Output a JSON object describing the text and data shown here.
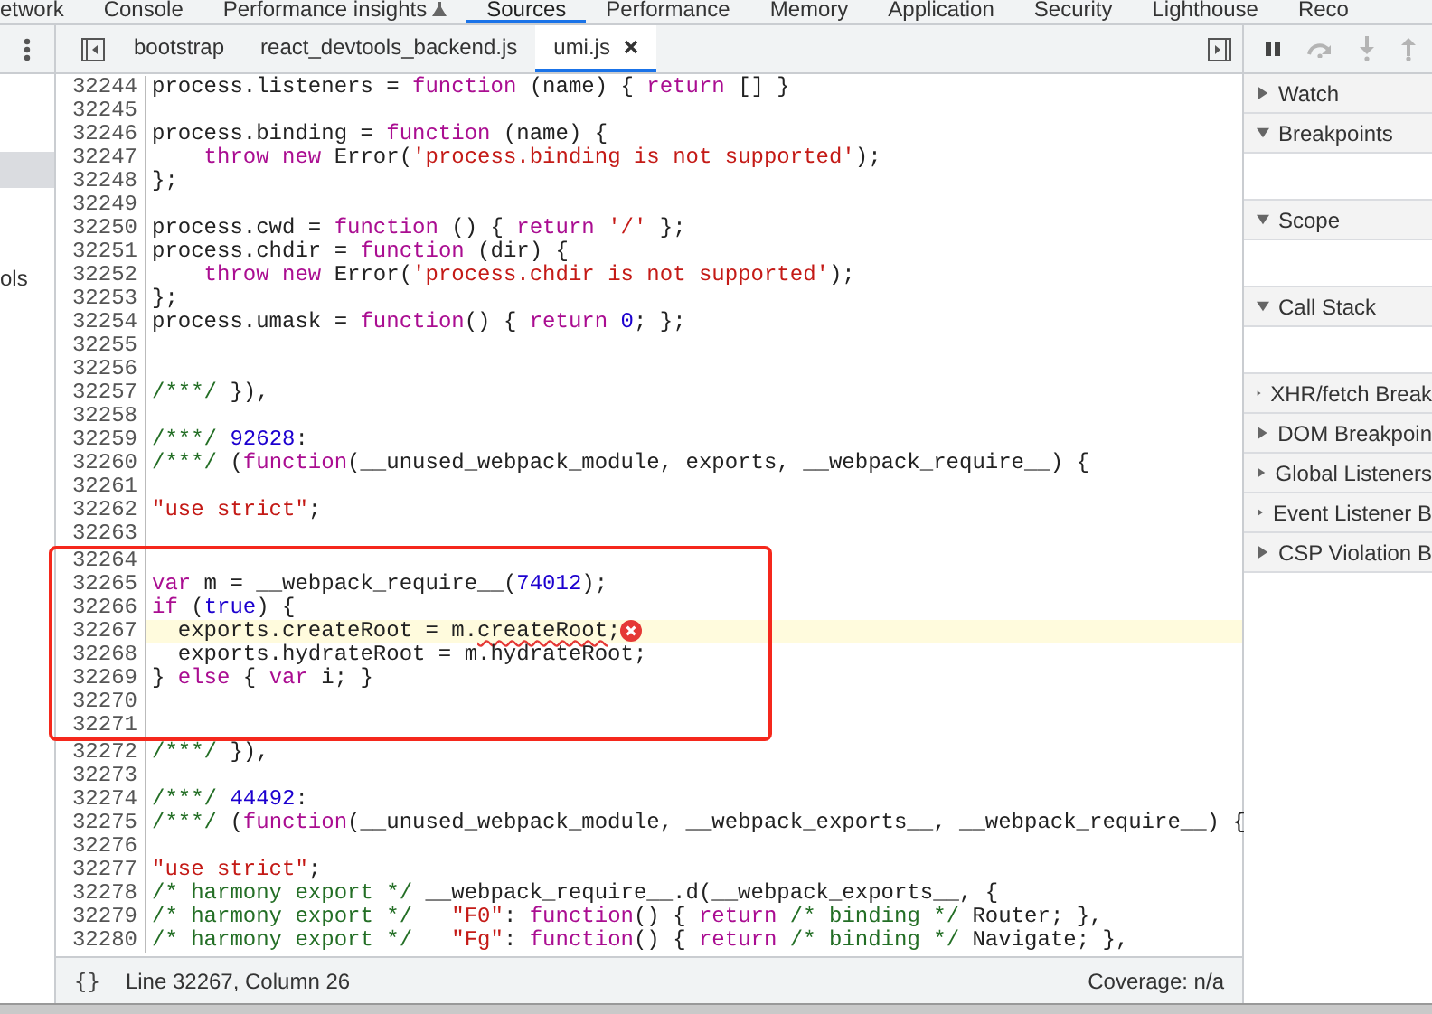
{
  "top_tabs": [
    {
      "label": "etwork",
      "selected": false,
      "has_icon": false
    },
    {
      "label": "Console",
      "selected": false,
      "has_icon": false
    },
    {
      "label": "Performance insights",
      "selected": false,
      "has_icon": true
    },
    {
      "label": "Sources",
      "selected": true,
      "has_icon": false
    },
    {
      "label": "Performance",
      "selected": false,
      "has_icon": false
    },
    {
      "label": "Memory",
      "selected": false,
      "has_icon": false
    },
    {
      "label": "Application",
      "selected": false,
      "has_icon": false
    },
    {
      "label": "Security",
      "selected": false,
      "has_icon": false
    },
    {
      "label": "Lighthouse",
      "selected": false,
      "has_icon": false
    },
    {
      "label": "Reco",
      "selected": false,
      "has_icon": false
    }
  ],
  "sidebar": {
    "items": [
      {
        "selected": true
      },
      {
        "label": "ols",
        "selected": false
      }
    ]
  },
  "editor_tabs": [
    {
      "label": "bootstrap",
      "selected": false
    },
    {
      "label": "react_devtools_backend.js",
      "selected": false
    },
    {
      "label": "umi.js",
      "selected": true
    }
  ],
  "code_blocks": [
    {
      "boxed": false,
      "lines": [
        {
          "number": "32244",
          "highlighted": false,
          "tokens": [
            {
              "kind": "plain",
              "text": "process.listeners ="
            },
            {
              "kind": "keyword",
              "text": " function"
            },
            {
              "kind": "plain",
              "text": " (name) {"
            },
            {
              "kind": "keyword",
              "text": " return"
            },
            {
              "kind": "plain",
              "text": " [] }"
            }
          ]
        },
        {
          "number": "32245",
          "highlighted": false
        },
        {
          "number": "32246",
          "highlighted": false,
          "tokens": [
            {
              "kind": "plain",
              "text": "process.binding ="
            },
            {
              "kind": "keyword",
              "text": " function"
            },
            {
              "kind": "plain",
              "text": " (name) {"
            }
          ]
        },
        {
          "number": "32247",
          "highlighted": false,
          "tokens": [
            {
              "kind": "keyword",
              "text": "    throw new"
            },
            {
              "kind": "plain",
              "text": " Error("
            },
            {
              "kind": "string",
              "text": "'process.binding is not supported'"
            },
            {
              "kind": "plain",
              "text": ");"
            }
          ]
        },
        {
          "number": "32248",
          "highlighted": false,
          "tokens": [
            {
              "kind": "plain",
              "text": "};"
            }
          ]
        },
        {
          "number": "32249",
          "highlighted": false
        },
        {
          "number": "32250",
          "highlighted": false,
          "tokens": [
            {
              "kind": "plain",
              "text": "process.cwd ="
            },
            {
              "kind": "keyword",
              "text": " function"
            },
            {
              "kind": "plain",
              "text": " () {"
            },
            {
              "kind": "keyword",
              "text": " return"
            },
            {
              "kind": "string",
              "text": " '/'"
            },
            {
              "kind": "plain",
              "text": " };"
            }
          ]
        },
        {
          "number": "32251",
          "highlighted": false,
          "tokens": [
            {
              "kind": "plain",
              "text": "process.chdir ="
            },
            {
              "kind": "keyword",
              "text": " function"
            },
            {
              "kind": "plain",
              "text": " (dir) {"
            }
          ]
        },
        {
          "number": "32252",
          "highlighted": false,
          "tokens": [
            {
              "kind": "keyword",
              "text": "    throw new"
            },
            {
              "kind": "plain",
              "text": " Error("
            },
            {
              "kind": "string",
              "text": "'process.chdir is not supported'"
            },
            {
              "kind": "plain",
              "text": ");"
            }
          ]
        },
        {
          "number": "32253",
          "highlighted": false,
          "tokens": [
            {
              "kind": "plain",
              "text": "};"
            }
          ]
        },
        {
          "number": "32254",
          "highlighted": false,
          "tokens": [
            {
              "kind": "plain",
              "text": "process.umask ="
            },
            {
              "kind": "keyword",
              "text": " function"
            },
            {
              "kind": "plain",
              "text": "() {"
            },
            {
              "kind": "keyword",
              "text": " return"
            },
            {
              "kind": "number",
              "text": " 0"
            },
            {
              "kind": "plain",
              "text": "; };"
            }
          ]
        },
        {
          "number": "32255",
          "highlighted": false
        },
        {
          "number": "32256",
          "highlighted": false
        },
        {
          "number": "32257",
          "highlighted": false,
          "tokens": [
            {
              "kind": "comment",
              "text": "/***/"
            },
            {
              "kind": "plain",
              "text": " }),"
            }
          ]
        },
        {
          "number": "32258",
          "highlighted": false
        },
        {
          "number": "32259",
          "highlighted": false,
          "tokens": [
            {
              "kind": "comment",
              "text": "/***/"
            },
            {
              "kind": "number",
              "text": " 92628"
            },
            {
              "kind": "plain",
              "text": ":"
            }
          ]
        },
        {
          "number": "32260",
          "highlighted": false,
          "tokens": [
            {
              "kind": "comment",
              "text": "/***/"
            },
            {
              "kind": "plain",
              "text": " ("
            },
            {
              "kind": "keyword",
              "text": "function"
            },
            {
              "kind": "plain",
              "text": "(__unused_webpack_module, exports, __webpack_require__) {"
            }
          ]
        },
        {
          "number": "32261",
          "highlighted": false
        },
        {
          "number": "32262",
          "highlighted": false,
          "tokens": [
            {
              "kind": "string",
              "text": "\"use strict\""
            },
            {
              "kind": "plain",
              "text": ";"
            }
          ]
        },
        {
          "number": "32263",
          "highlighted": false
        }
      ]
    },
    {
      "boxed": true,
      "lines": [
        {
          "number": "32264",
          "highlighted": false
        },
        {
          "number": "32265",
          "highlighted": false,
          "tokens": [
            {
              "kind": "keyword",
              "text": "var"
            },
            {
              "kind": "plain",
              "text": " m = __webpack_require__("
            },
            {
              "kind": "number",
              "text": "74012"
            },
            {
              "kind": "plain",
              "text": ");"
            }
          ]
        },
        {
          "number": "32266",
          "highlighted": false,
          "tokens": [
            {
              "kind": "keyword",
              "text": "if"
            },
            {
              "kind": "plain",
              "text": " ("
            },
            {
              "kind": "atom",
              "text": "true"
            },
            {
              "kind": "plain",
              "text": ") {"
            }
          ]
        },
        {
          "number": "32267",
          "highlighted": true,
          "tokens": [
            {
              "kind": "plain",
              "text": "  exports.createRoot = m."
            },
            {
              "kind": "squiggle",
              "text": "createRoot"
            },
            {
              "kind": "plain",
              "text": ";"
            },
            {
              "kind": "error_marker"
            }
          ]
        },
        {
          "number": "32268",
          "highlighted": false,
          "tokens": [
            {
              "kind": "plain",
              "text": "  exports.hydrateRoot = m.hydrateRoot;"
            }
          ]
        },
        {
          "number": "32269",
          "highlighted": false,
          "tokens": [
            {
              "kind": "plain",
              "text": "}"
            },
            {
              "kind": "keyword",
              "text": " else"
            },
            {
              "kind": "plain",
              "text": " {"
            },
            {
              "kind": "keyword",
              "text": " var"
            },
            {
              "kind": "plain",
              "text": " i; }"
            }
          ]
        },
        {
          "number": "32270",
          "highlighted": false
        },
        {
          "number": "32271",
          "highlighted": false
        }
      ]
    },
    {
      "boxed": false,
      "lines": [
        {
          "number": "32272",
          "highlighted": false,
          "tokens": [
            {
              "kind": "comment",
              "text": "/***/"
            },
            {
              "kind": "plain",
              "text": " }),"
            }
          ]
        },
        {
          "number": "32273",
          "highlighted": false
        },
        {
          "number": "32274",
          "highlighted": false,
          "tokens": [
            {
              "kind": "comment",
              "text": "/***/"
            },
            {
              "kind": "number",
              "text": " 44492"
            },
            {
              "kind": "plain",
              "text": ":"
            }
          ]
        },
        {
          "number": "32275",
          "highlighted": false,
          "tokens": [
            {
              "kind": "comment",
              "text": "/***/"
            },
            {
              "kind": "plain",
              "text": " ("
            },
            {
              "kind": "keyword",
              "text": "function"
            },
            {
              "kind": "plain",
              "text": "(__unused_webpack_module, __webpack_exports__, __webpack_require__) {"
            }
          ]
        },
        {
          "number": "32276",
          "highlighted": false
        },
        {
          "number": "32277",
          "highlighted": false,
          "tokens": [
            {
              "kind": "string",
              "text": "\"use strict\""
            },
            {
              "kind": "plain",
              "text": ";"
            }
          ]
        },
        {
          "number": "32278",
          "highlighted": false,
          "tokens": [
            {
              "kind": "comment",
              "text": "/* harmony export */"
            },
            {
              "kind": "plain",
              "text": " __webpack_require__.d(__webpack_exports__, {"
            }
          ]
        },
        {
          "number": "32279",
          "highlighted": false,
          "tokens": [
            {
              "kind": "comment",
              "text": "/* harmony export */"
            },
            {
              "kind": "string",
              "text": "   \"F0\""
            },
            {
              "kind": "plain",
              "text": ":"
            },
            {
              "kind": "keyword",
              "text": " function"
            },
            {
              "kind": "plain",
              "text": "() {"
            },
            {
              "kind": "keyword",
              "text": " return"
            },
            {
              "kind": "comment",
              "text": " /* binding */"
            },
            {
              "kind": "plain",
              "text": " Router; },"
            }
          ]
        },
        {
          "number": "32280",
          "highlighted": false,
          "tokens": [
            {
              "kind": "comment",
              "text": "/* harmony export */"
            },
            {
              "kind": "string",
              "text": "   \"Fg\""
            },
            {
              "kind": "plain",
              "text": ":"
            },
            {
              "kind": "keyword",
              "text": " function"
            },
            {
              "kind": "plain",
              "text": "() {"
            },
            {
              "kind": "keyword",
              "text": " return"
            },
            {
              "kind": "comment",
              "text": " /* binding */"
            },
            {
              "kind": "plain",
              "text": " Navigate; },"
            }
          ]
        }
      ]
    }
  ],
  "status_bar": {
    "pretty_print": "{}",
    "position": "Line 32267, Column 26",
    "coverage": "Coverage: n/a"
  },
  "debugger_controls": [
    {
      "kind": "pause",
      "disabled": false
    },
    {
      "kind": "step-over",
      "disabled": true
    },
    {
      "kind": "step-into",
      "disabled": true
    },
    {
      "kind": "step-out",
      "disabled": true
    }
  ],
  "debugger_sections": [
    {
      "title": "Watch",
      "expanded": false
    },
    {
      "title": "Breakpoints",
      "expanded": true
    },
    {
      "title": "Scope",
      "expanded": true
    },
    {
      "title": "Call Stack",
      "expanded": true
    },
    {
      "title": "XHR/fetch Break",
      "expanded": false
    },
    {
      "title": "DOM Breakpoin",
      "expanded": false
    },
    {
      "title": "Global Listeners",
      "expanded": false
    },
    {
      "title": "Event Listener B",
      "expanded": false
    },
    {
      "title": "CSP Violation B",
      "expanded": false
    }
  ]
}
